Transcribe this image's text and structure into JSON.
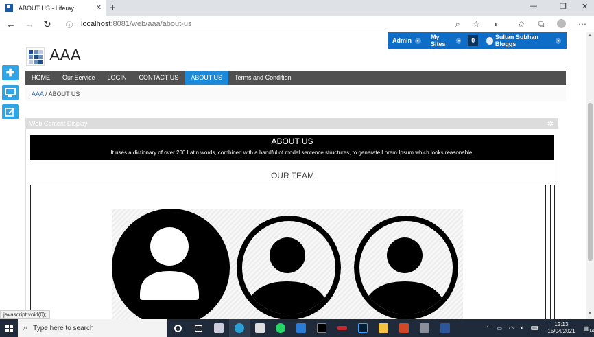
{
  "browser": {
    "tab_title": "ABOUT US - Liferay",
    "tab_close": "✕",
    "new_tab": "+",
    "url_host": "localhost",
    "url_path": ":8081/web/aaa/about-us"
  },
  "dockbar": {
    "admin": "Admin",
    "my_sites": "My Sites",
    "notifications": "0",
    "user": "Sultan Subhan Bloggs"
  },
  "site": {
    "name": "AAA",
    "nav": [
      {
        "label": "HOME"
      },
      {
        "label": "Our Service"
      },
      {
        "label": "LOGIN"
      },
      {
        "label": "CONTACT US"
      },
      {
        "label": "ABOUT US"
      },
      {
        "label": "Terms and Condition"
      }
    ],
    "breadcrumb": {
      "root": "AAA",
      "sep": "/",
      "current": "ABOUT US"
    }
  },
  "portlet": {
    "title": "Web Content Display",
    "banner_title": "ABOUT US",
    "banner_text": "It uses a dictionary of over 200 Latin words, combined with a handful of model sentence structures, to generate Lorem Ipsum which looks reasonable.",
    "team_heading": "OUR TEAM"
  },
  "status_text": "javascript:void(0);",
  "taskbar": {
    "search_placeholder": "Type here to search",
    "time": "12:13",
    "date": "15/04/2021",
    "notification_count": "14"
  }
}
